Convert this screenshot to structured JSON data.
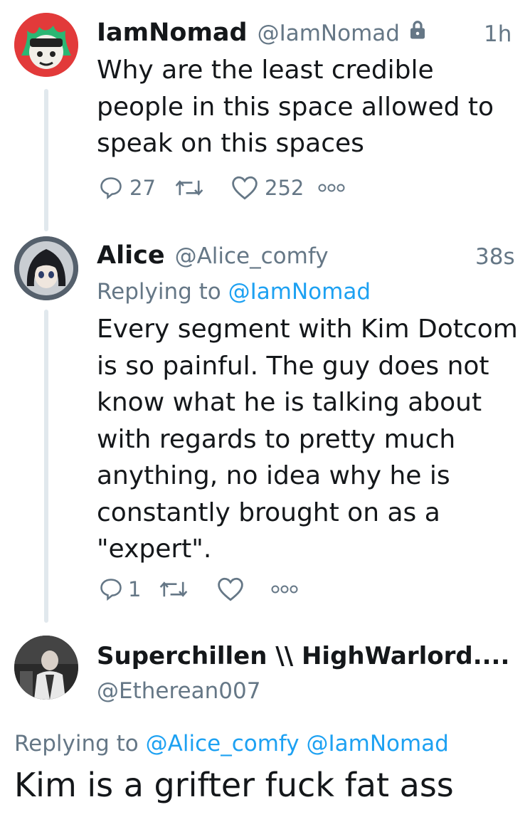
{
  "tweets": [
    {
      "name": "IamNomad",
      "handle": "@IamNomad",
      "time": "1h",
      "text": "Why are the least credible people in this space allowed to speak on this spaces",
      "replies": "27",
      "retweets": "",
      "likes": "252",
      "protected_icon": "lock-icon"
    },
    {
      "name": "Alice",
      "handle": "@Alice_comfy",
      "time": "38s",
      "replying_prefix": "Replying to",
      "replying_to": "@IamNomad",
      "text": "Every segment with Kim Dotcom is so painful. The guy does not know what he is talking about with regards to pretty much anything, no idea why he is constantly brought on as a \"expert\".",
      "replies": "1",
      "retweets": "",
      "likes": ""
    },
    {
      "name": "Superchillen \\\\ HighWarlord....",
      "handle": "@Etherean007",
      "replying_prefix": "Replying to",
      "replying_to_1": "@Alice_comfy",
      "replying_to_2": "@IamNomad",
      "text": "Kim is a grifter fuck fat ass"
    }
  ],
  "icons": [
    "reply-icon",
    "retweet-icon",
    "like-icon",
    "more-icon",
    "lock-icon"
  ],
  "colors": {
    "link": "#1da1f2",
    "secondary_text": "#657786",
    "thread_line": "#e1e8ed"
  }
}
